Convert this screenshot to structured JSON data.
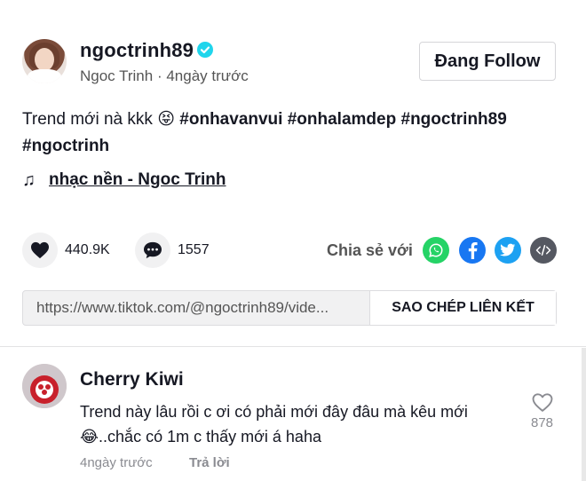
{
  "post": {
    "username": "ngoctrinh89",
    "nickname": "Ngoc Trinh",
    "time_ago": "4ngày trước",
    "follow_label": "Đang Follow",
    "description_text": "Trend mới nà kkk",
    "emoji": "😝",
    "hashtags": [
      "#onhavanvui",
      "#onhalamdep",
      "#ngoctrinh89",
      "#ngoctrinh"
    ],
    "music_label": "nhạc nền - Ngoc Trinh",
    "likes": "440.9K",
    "comments": "1557",
    "share_label": "Chia sẻ với",
    "link_url": "https://www.tiktok.com/@ngoctrinh89/vide...",
    "copy_label": "SAO CHÉP LIÊN KẾT"
  },
  "comment": {
    "author": "Cherry Kiwi",
    "text_line1": "Trend này lâu rồi c ơi có phải mới đây đâu mà kêu mới",
    "text_line2_emoji": "😂",
    "text_line2": "..chắc có 1m c thấy mới á haha",
    "time_ago": "4ngày trước",
    "reply_label": "Trả lời",
    "like_count": "878"
  },
  "icons": {
    "whatsapp": "#25D366",
    "facebook": "#1877F2",
    "twitter": "#1DA1F2",
    "embed": "#555861"
  }
}
